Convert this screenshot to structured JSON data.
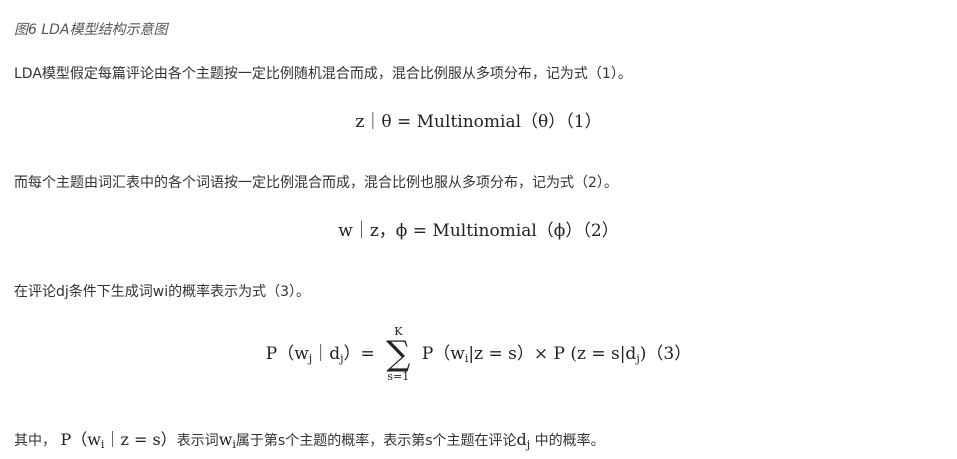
{
  "caption": "图6 LDA模型结构示意图",
  "para1": "LDA模型假定每篇评论由各个主题按一定比例随机混合而成，混合比例服从多项分布，记为式（1）。",
  "formula1": "z｜θ = Multinomial（θ）（1）",
  "para2": "而每个主题由词汇表中的各个词语按一定比例混合而成，混合比例也服从多项分布，记为式（2）。",
  "formula2": "w｜z，ϕ = Multinomial（ϕ）（2）",
  "para3": "在评论dj条件下生成词wi的概率表示为式（3）。",
  "formula3": {
    "lhs_pre": "P（w",
    "lhs_sub1": "j",
    "lhs_mid": "｜d",
    "lhs_sub2": "j",
    "lhs_post": "）=",
    "sum_upper": "K",
    "sum_symbol": "∑",
    "sum_lower": "s=1",
    "rhs_1": "P（w",
    "rhs_sub1": "i",
    "rhs_2": "|z = s）× P (z = s|d",
    "rhs_sub2": "j",
    "rhs_3": ")（3）"
  },
  "para4": {
    "t1": "其中，",
    "m1": "P（w",
    "m1_sub": "i",
    "m1_post": "｜z = s）",
    "t2": "表示词",
    "m2": "w",
    "m2_sub": "i",
    "t3": "属于第s个主题的概率，表示第s个主题在评论",
    "m3": "d",
    "m3_sub": "j",
    "t4": "中的概率。"
  }
}
